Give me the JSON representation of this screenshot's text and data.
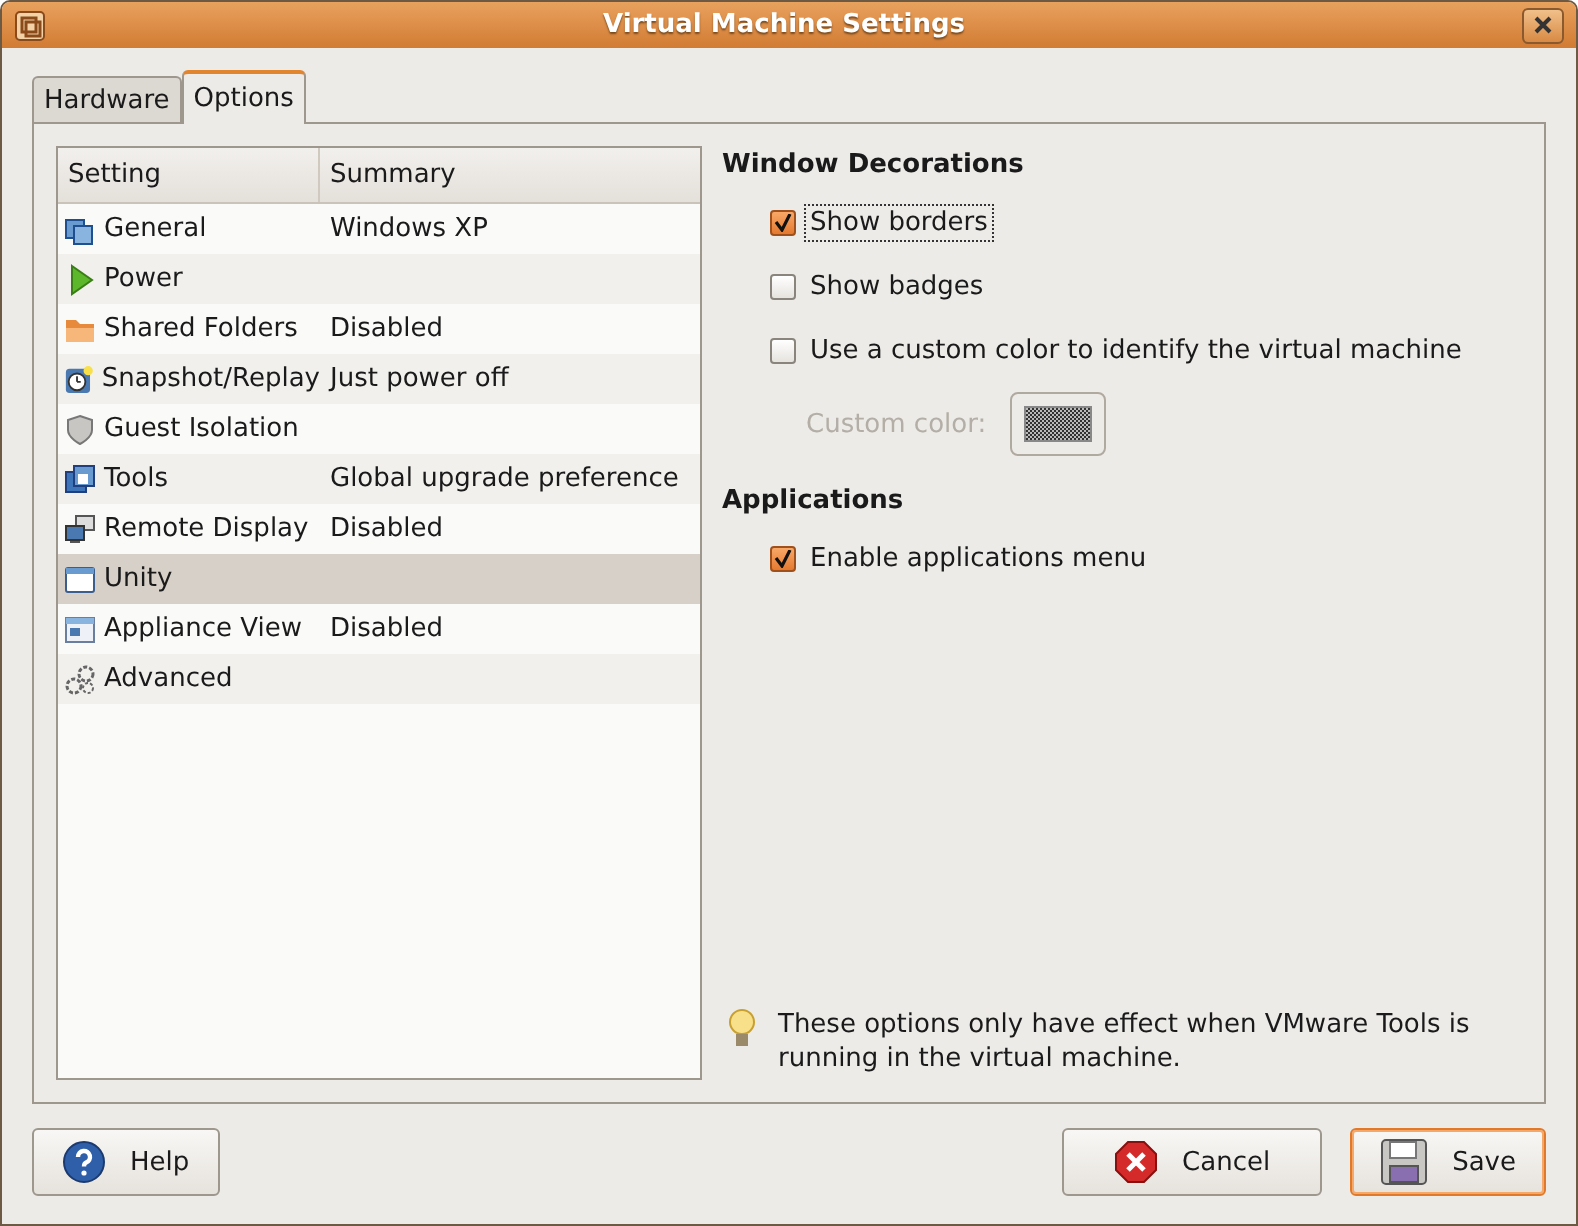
{
  "window": {
    "title": "Virtual Machine Settings"
  },
  "tabs": [
    {
      "label": "Hardware",
      "selected": false
    },
    {
      "label": "Options",
      "selected": true
    }
  ],
  "settings_list": {
    "columns": [
      "Setting",
      "Summary"
    ],
    "rows": [
      {
        "setting": "General",
        "summary": "Windows XP",
        "selected": false
      },
      {
        "setting": "Power",
        "selected": false
      },
      {
        "setting": "Shared Folders",
        "summary": "Disabled",
        "selected": false
      },
      {
        "setting": "Snapshot/Replay",
        "summary": "Just power off",
        "selected": false
      },
      {
        "setting": "Guest Isolation",
        "selected": false
      },
      {
        "setting": "Tools",
        "summary": "Global upgrade preference",
        "selected": false
      },
      {
        "setting": "Remote Display",
        "summary": "Disabled",
        "selected": false
      },
      {
        "setting": "Unity",
        "selected": true
      },
      {
        "setting": "Appliance View",
        "summary": "Disabled",
        "selected": false
      },
      {
        "setting": "Advanced",
        "selected": false
      }
    ]
  },
  "window_decorations": {
    "heading": "Window Decorations",
    "options": [
      {
        "label": "Show borders",
        "checked": true,
        "focused": true
      },
      {
        "label": "Show badges",
        "checked": false,
        "focused": false
      },
      {
        "label": "Use a custom color to identify the virtual machine",
        "checked": false,
        "focused": false
      }
    ],
    "custom_color": {
      "label": "Custom color:",
      "disabled": true
    }
  },
  "applications": {
    "heading": "Applications",
    "options": [
      {
        "label": "Enable applications menu",
        "checked": true,
        "focused": false
      }
    ]
  },
  "hint": "These options only have effect when VMware Tools is running in the virtual machine.",
  "buttons": [
    {
      "label": "Help",
      "kind": "help",
      "default": false
    },
    {
      "label": "Cancel",
      "kind": "cancel",
      "default": false
    },
    {
      "label": "Save",
      "kind": "save",
      "default": true
    }
  ]
}
